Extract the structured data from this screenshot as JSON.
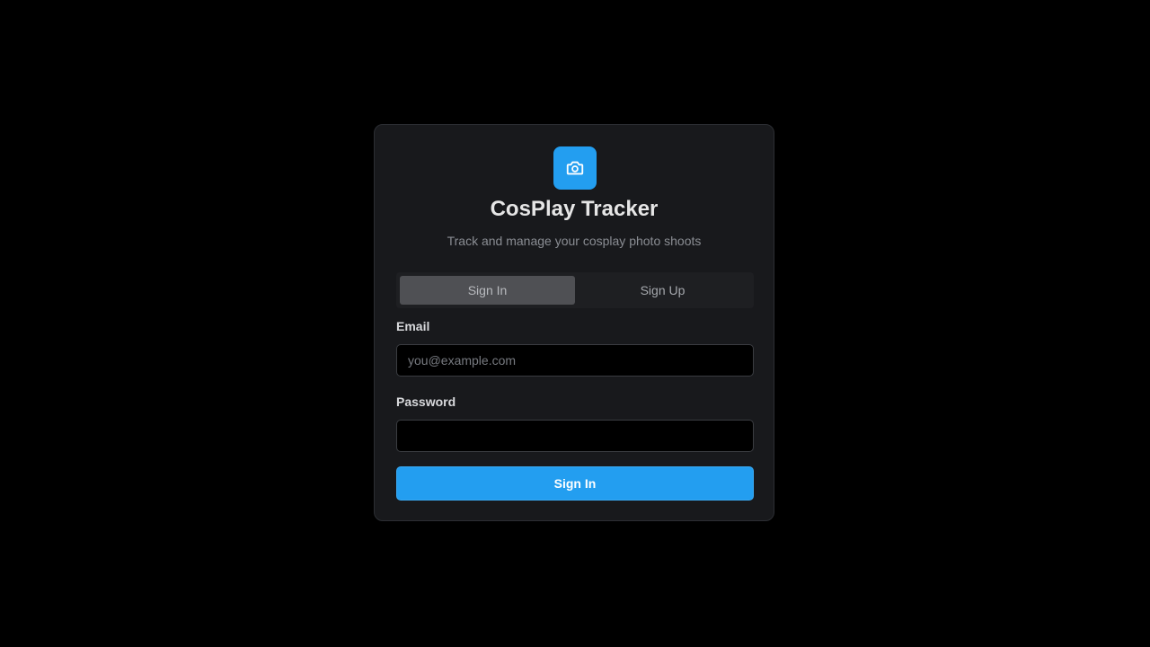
{
  "app": {
    "icon": "camera-icon",
    "title": "CosPlay Tracker",
    "subtitle": "Track and manage your cosplay photo shoots"
  },
  "tabs": [
    {
      "label": "Sign In",
      "active": true
    },
    {
      "label": "Sign Up",
      "active": false
    }
  ],
  "form": {
    "email_label": "Email",
    "email_placeholder": "you@example.com",
    "email_value": "",
    "password_label": "Password",
    "password_placeholder": "",
    "password_value": "",
    "submit_label": "Sign In"
  },
  "colors": {
    "accent": "#239ef0",
    "background": "#000000",
    "card": "#18191c"
  }
}
